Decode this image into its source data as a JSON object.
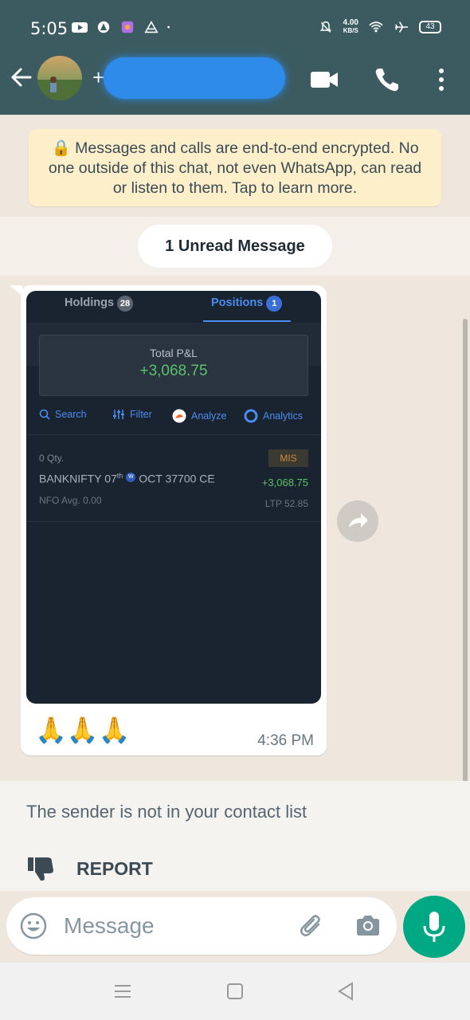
{
  "status": {
    "time": "5:05",
    "speed_value": "4.00",
    "speed_unit": "KB/S",
    "battery": "43",
    "icons": [
      "youtube-icon",
      "app-icon",
      "gallery-icon",
      "signal-app-icon",
      "dot-icon",
      "mute-icon",
      "wifi-icon",
      "airplane-icon",
      "battery-icon"
    ]
  },
  "header": {
    "contact_prefix": "+",
    "icons": [
      "back-arrow-icon",
      "avatar",
      "video-call-icon",
      "voice-call-icon",
      "more-vert-icon"
    ],
    "bar_color": "#3b5b60"
  },
  "chat": {
    "encryption_notice": "🔒 Messages and calls are end-to-end encrypted. No one outside of this chat, not even WhatsApp, can read or listen to them. Tap to learn more.",
    "unread_label": "1 Unread Message",
    "message": {
      "time": "4:36 PM",
      "emojis": "🙏🙏🙏",
      "screenshot": {
        "tab_holdings": "Holdings",
        "holdings_count": "28",
        "tab_positions": "Positions",
        "positions_count": "1",
        "total_pnl_label": "Total P&L",
        "total_pnl_value": "+3,068.75",
        "tools": {
          "search": "Search",
          "filter": "Filter",
          "analyze": "Analyze",
          "analytics": "Analytics"
        },
        "position": {
          "qty": "0 Qty.",
          "product": "MIS",
          "symbol_prefix": "BANKNIFTY 07",
          "symbol_sup": "th",
          "weekly_badge": "W",
          "symbol_suffix": "OCT 37700 CE",
          "pnl": "+3,068.75",
          "exchange": "NFO  Avg. 0.00",
          "ltp": "LTP 52.85"
        }
      }
    }
  },
  "notice": {
    "text": "The sender is not in your contact list",
    "report_label": "REPORT"
  },
  "input": {
    "placeholder": "Message"
  },
  "colors": {
    "accent": "#00a884",
    "chat_bg": "#efe7dd",
    "pnl_green": "#5ac26a",
    "positions_blue": "#4a8cf0"
  }
}
